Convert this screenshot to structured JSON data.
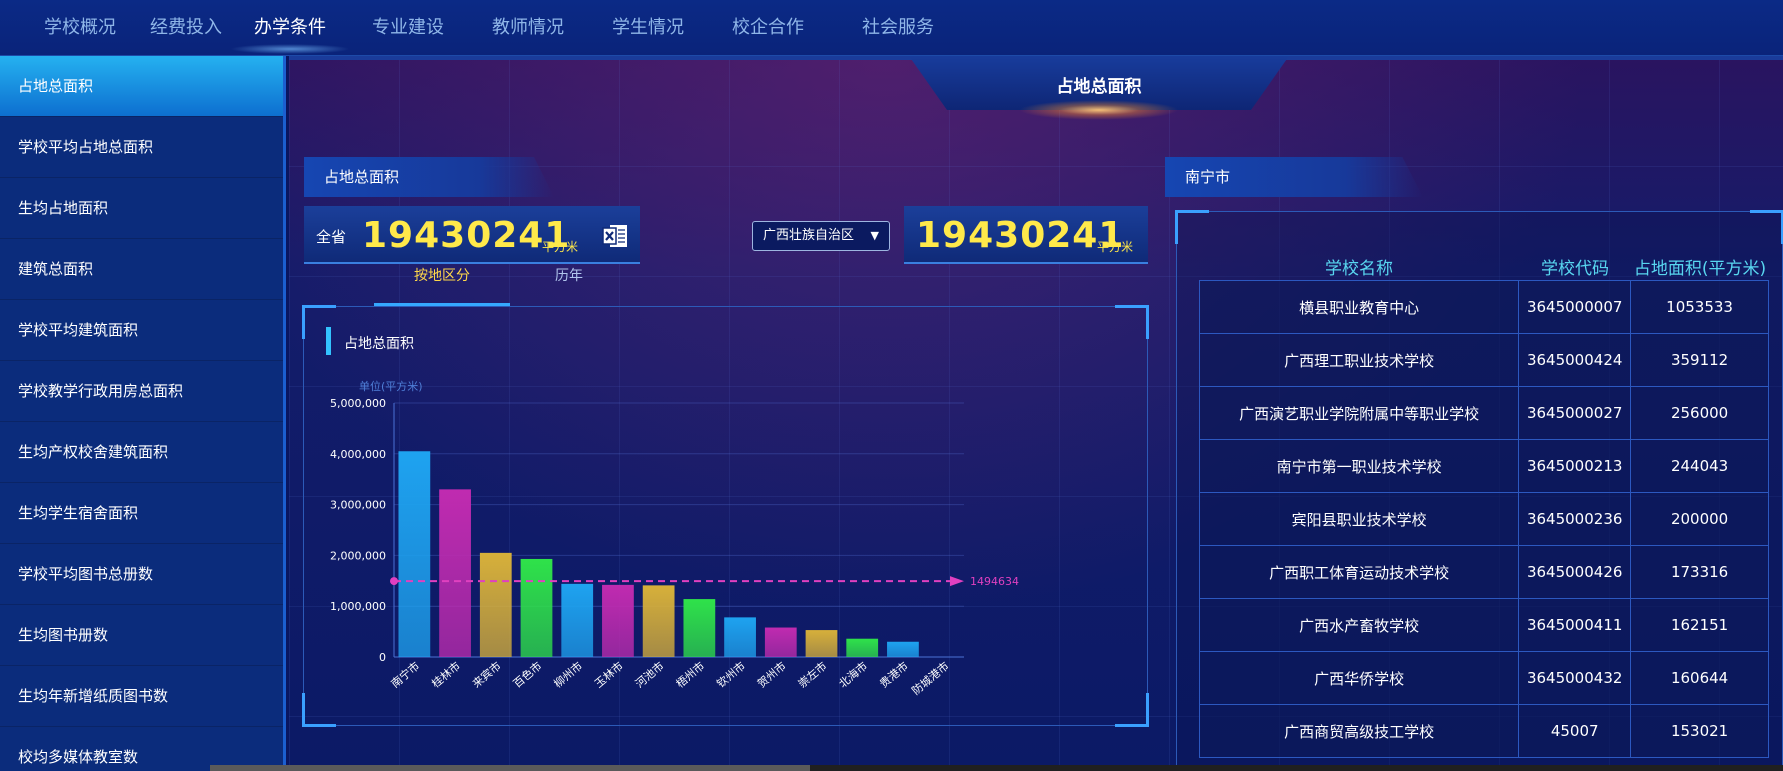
{
  "nav": {
    "tabs": [
      "学校概况",
      "经费投入",
      "办学条件",
      "专业建设",
      "教师情况",
      "学生情况",
      "校企合作",
      "社会服务"
    ],
    "active_index": 2
  },
  "sidebar": {
    "items": [
      "占地总面积",
      "学校平均占地总面积",
      "生均占地面积",
      "建筑总面积",
      "学校平均建筑面积",
      "学校教学行政用房总面积",
      "生均产权校舍建筑面积",
      "生均学生宿舍面积",
      "学校平均图书总册数",
      "生均图书册数",
      "生均年新增纸质图书数",
      "校均多媒体教室数"
    ],
    "active_index": 0
  },
  "page": {
    "title": "占地总面积"
  },
  "left_panel": {
    "header": "占地总面积",
    "stat": {
      "label": "全省",
      "value": "19430241",
      "unit": "平方米"
    },
    "export_icon": "excel-icon"
  },
  "region_select": {
    "value": "广西壮族自治区",
    "caret": "▼"
  },
  "region_stat": {
    "value": "19430241",
    "unit": "平方米"
  },
  "subtabs": {
    "items": [
      "按地区分",
      "历年"
    ],
    "active_index": 0
  },
  "chart": {
    "panel_title": "占地总面积"
  },
  "chart_data": {
    "type": "bar",
    "title": "",
    "ylabel": "单位(平方米)",
    "xlabel": "",
    "ylim": [
      0,
      5000000
    ],
    "yticks": [
      "0",
      "1,000,000",
      "2,000,000",
      "3,000,000",
      "4,000,000",
      "5,000,000"
    ],
    "categories": [
      "南宁市",
      "桂林市",
      "来宾市",
      "百色市",
      "柳州市",
      "玉林市",
      "河池市",
      "梧州市",
      "钦州市",
      "贺州市",
      "崇左市",
      "北海市",
      "贵港市",
      "防城港市"
    ],
    "values": [
      4050000,
      3300000,
      2050000,
      1930000,
      1440000,
      1420000,
      1410000,
      1140000,
      780000,
      580000,
      530000,
      360000,
      300000,
      0
    ],
    "bar_colors": [
      "#1ea3f0",
      "#c02bb0",
      "#d7b03a",
      "#2fe24a",
      "#1ea3f0",
      "#c02bb0",
      "#d7b03a",
      "#2fe24a",
      "#1ea3f0",
      "#c02bb0",
      "#d7b03a",
      "#2fe24a",
      "#1ea3f0",
      "#c02bb0"
    ],
    "average_line": {
      "value": 1494634,
      "label": "1494634",
      "color": "#e040c0"
    },
    "grid": true
  },
  "right_panel": {
    "header": "南宁市",
    "columns": [
      "学校名称",
      "学校代码",
      "占地面积(平方米)"
    ],
    "rows": [
      [
        "横县职业教育中心",
        "3645000007",
        "1053533"
      ],
      [
        "广西理工职业技术学校",
        "3645000424",
        "359112"
      ],
      [
        "广西演艺职业学院附属中等职业学校",
        "3645000027",
        "256000"
      ],
      [
        "南宁市第一职业技术学校",
        "3645000213",
        "244043"
      ],
      [
        "宾阳县职业技术学校",
        "3645000236",
        "200000"
      ],
      [
        "广西职工体育运动技术学校",
        "3645000426",
        "173316"
      ],
      [
        "广西水产畜牧学校",
        "3645000411",
        "162151"
      ],
      [
        "广西华侨学校",
        "3645000432",
        "160644"
      ],
      [
        "广西商贸高级技工学校",
        "45007",
        "153021"
      ]
    ]
  },
  "colors": {
    "accent": "#35a8ff",
    "highlight": "#ffe94a",
    "active_tab": "#ffd84a"
  }
}
